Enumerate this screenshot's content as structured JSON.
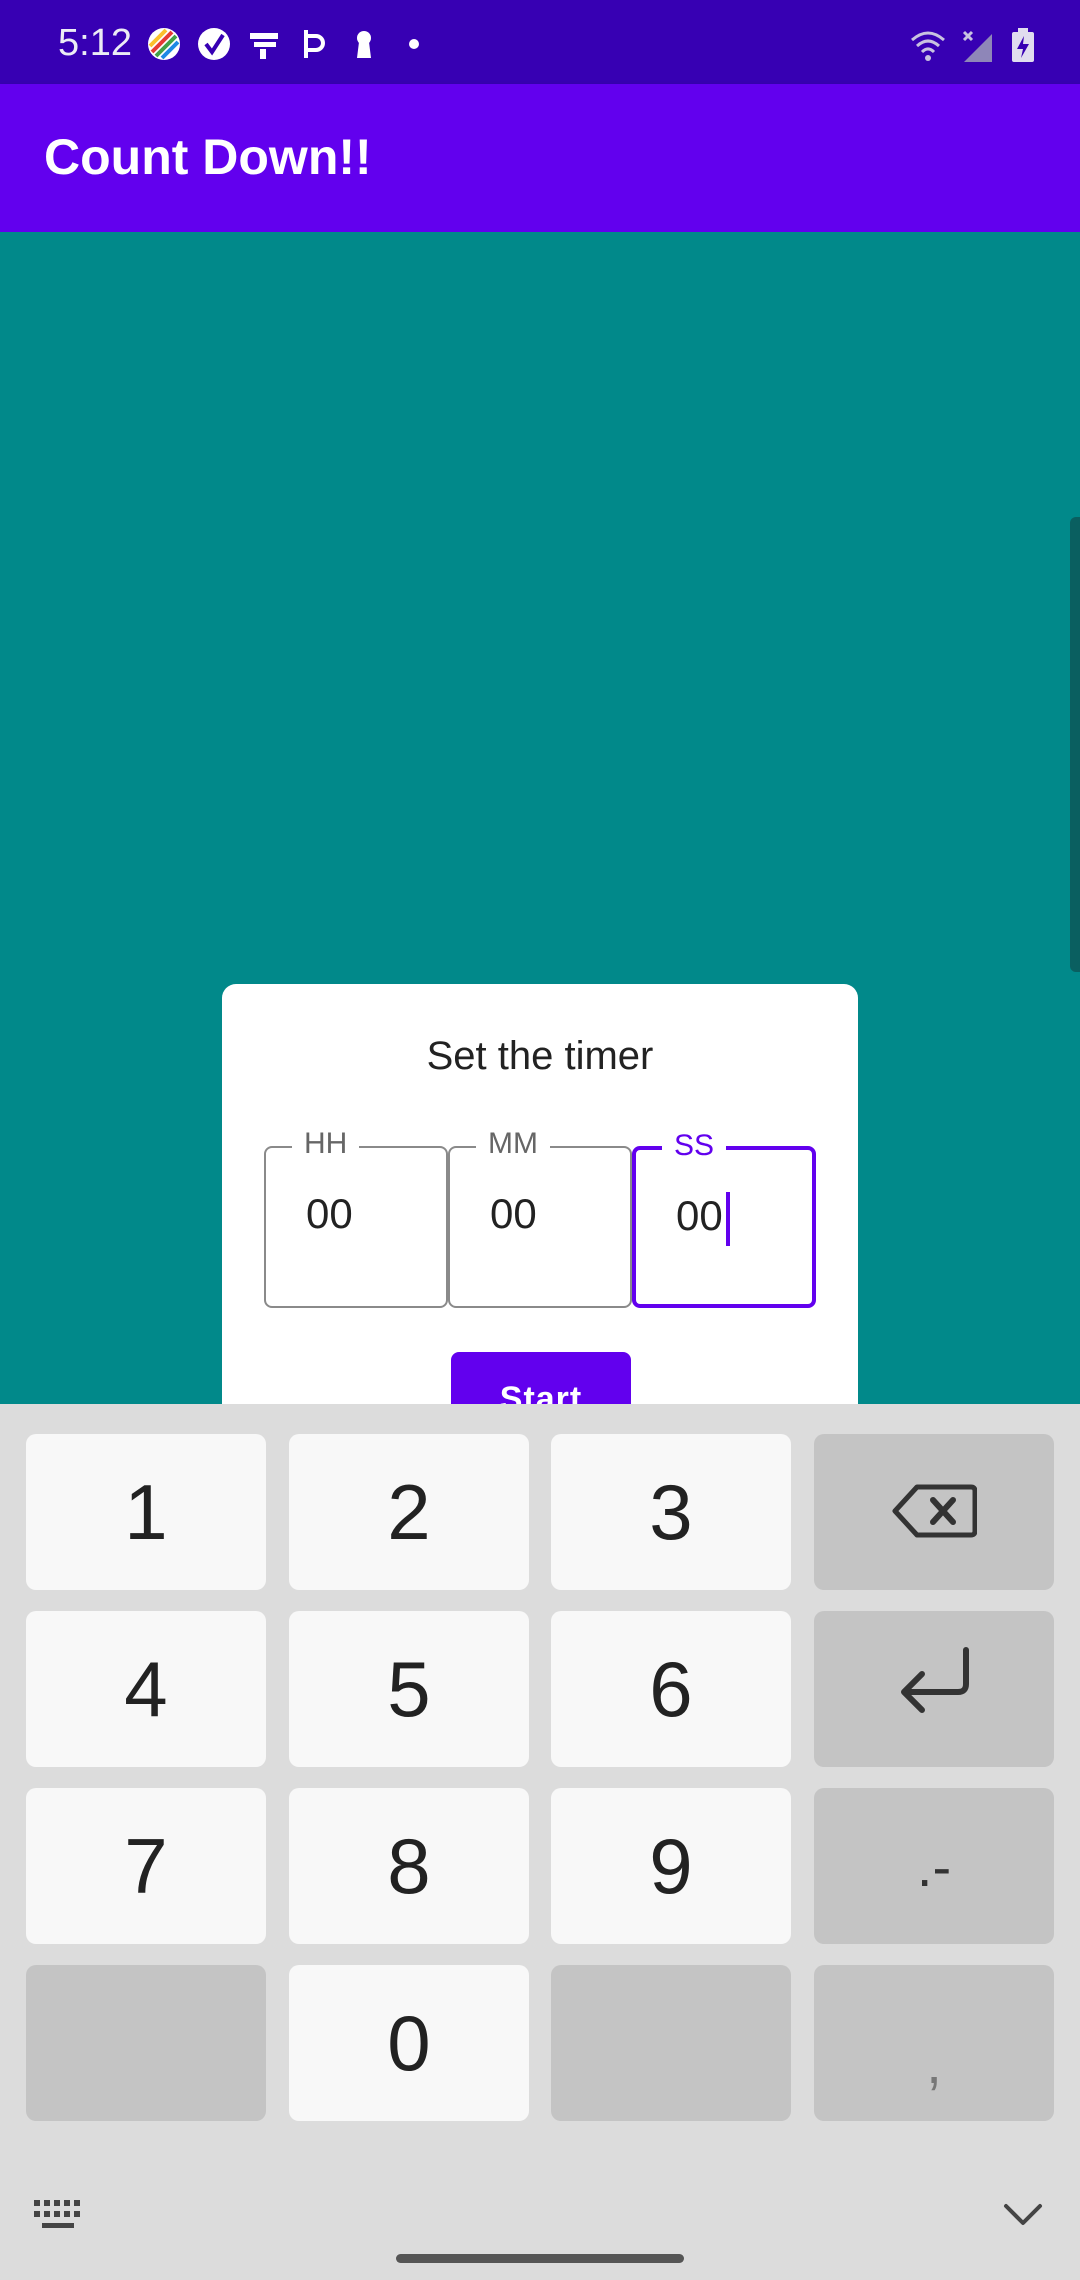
{
  "status_bar": {
    "time": "5:12",
    "left_icons": [
      "stripe-ball-icon",
      "check-circle-icon",
      "stacked-bars-icon",
      "p-letter-icon",
      "keyhole-icon",
      "dot-icon"
    ],
    "right_icons": [
      "wifi-icon",
      "cellular-off-icon",
      "battery-charging-icon"
    ]
  },
  "app_bar": {
    "title": "Count Down!!"
  },
  "dialog": {
    "title": "Set the timer",
    "fields": [
      {
        "label": "HH",
        "value": "00"
      },
      {
        "label": "MM",
        "value": "00"
      },
      {
        "label": "SS",
        "value": "00"
      }
    ],
    "start_label": "Start"
  },
  "keyboard": {
    "keys": [
      "1",
      "2",
      "3",
      "4",
      "5",
      "6",
      "7",
      "8",
      "9",
      "0",
      ".-",
      ","
    ],
    "left_bottom_icon": "keyboard-icon",
    "right_bottom_icon": "chevron-down-icon"
  },
  "colors": {
    "status_bar": "#3700b3",
    "app_bar": "#6200ee",
    "background": "#01898a",
    "accent": "#6200ee"
  }
}
